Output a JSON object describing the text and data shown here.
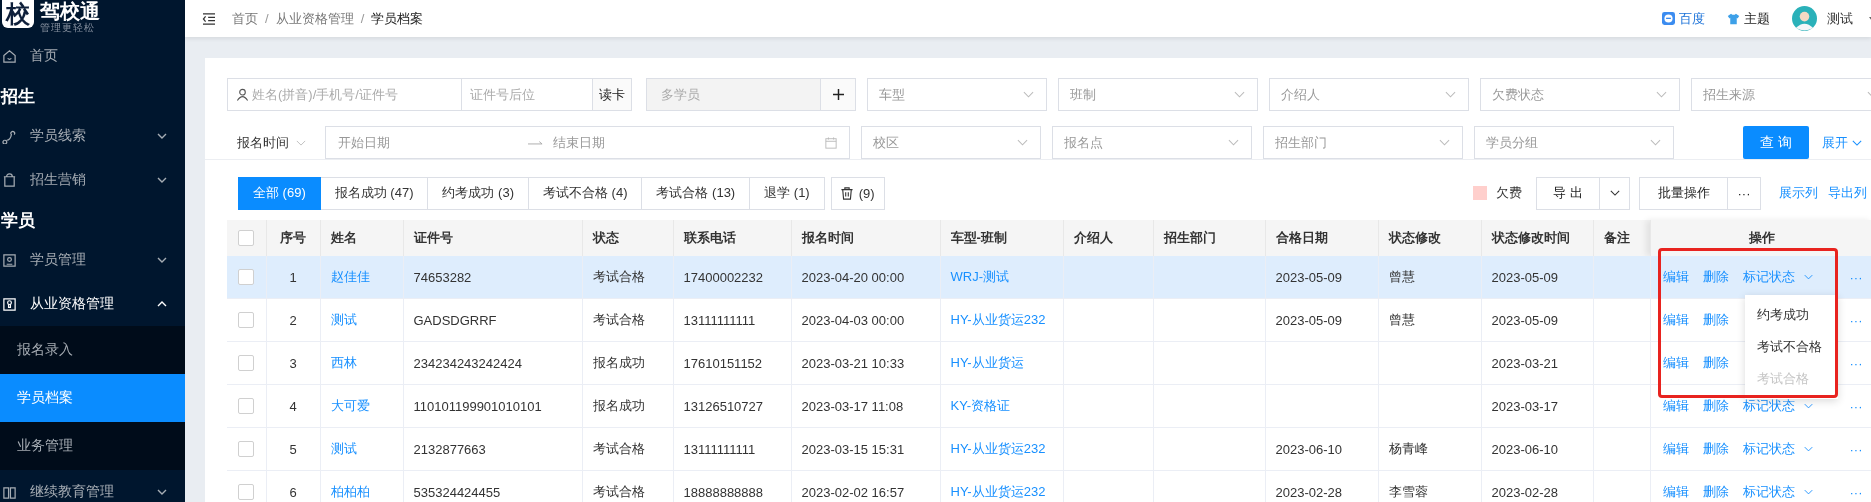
{
  "sidebar": {
    "logo": {
      "mark": "校",
      "name": "驾校通",
      "slogan": "管理更轻松"
    },
    "items": [
      {
        "kind": "item",
        "label": "首页"
      },
      {
        "kind": "section",
        "label": "招生"
      },
      {
        "kind": "item",
        "label": "学员线索",
        "expanded": false
      },
      {
        "kind": "item",
        "label": "招生营销",
        "expanded": false
      },
      {
        "kind": "section",
        "label": "学员"
      },
      {
        "kind": "item",
        "label": "学员管理",
        "expanded": false
      },
      {
        "kind": "item",
        "label": "从业资格管理",
        "expanded": true,
        "children": [
          {
            "label": "报名录入",
            "selected": false
          },
          {
            "label": "学员档案",
            "selected": true
          },
          {
            "label": "业务管理",
            "selected": false
          }
        ]
      },
      {
        "kind": "item",
        "label": "继续教育管理",
        "expanded": false
      }
    ]
  },
  "topbar": {
    "breadcrumb": [
      "首页",
      "从业资格管理",
      "学员档案"
    ],
    "separator": "/",
    "links": [
      {
        "kind": "browser",
        "label": "百度"
      },
      {
        "kind": "theme",
        "label": "主题"
      }
    ],
    "user": "测试"
  },
  "filters": {
    "name_search": {
      "placeholder": "姓名(拼音)/手机号/证件号"
    },
    "id_suffix": {
      "placeholder": "证件号后位"
    },
    "read_card": "读卡",
    "multi_student": {
      "placeholder": "多学员",
      "disabled": true
    },
    "selects_row1": [
      {
        "placeholder": "车型"
      },
      {
        "placeholder": "班制"
      },
      {
        "placeholder": "介绍人"
      },
      {
        "placeholder": "欠费状态"
      },
      {
        "placeholder": "招生来源"
      }
    ],
    "date_type": "报名时间",
    "date_start": {
      "placeholder": "开始日期"
    },
    "date_end": {
      "placeholder": "结束日期"
    },
    "selects_row2": [
      {
        "placeholder": "校区"
      },
      {
        "placeholder": "报名点"
      },
      {
        "placeholder": "招生部门"
      },
      {
        "placeholder": "学员分组"
      }
    ],
    "query_button": "查 询",
    "expand_link": "展开"
  },
  "tabs": [
    {
      "label": "全部 (69)",
      "selected": true
    },
    {
      "label": "报名成功 (47)",
      "selected": false
    },
    {
      "label": "约考成功 (3)",
      "selected": false
    },
    {
      "label": "考试不合格 (4)",
      "selected": false
    },
    {
      "label": "考试合格 (13)",
      "selected": false
    },
    {
      "label": "退学 (1)",
      "selected": false
    }
  ],
  "recycle_count": "(9)",
  "toolbar": {
    "legend": {
      "label": "欠费",
      "color": "#ffcfcc"
    },
    "export_button": "导 出",
    "batch_button": "批量操作",
    "more": "···",
    "links": [
      "展示列",
      "导出列"
    ]
  },
  "table": {
    "header_checked": false,
    "columns": [
      "序号",
      "姓名",
      "证件号",
      "状态",
      "联系电话",
      "报名时间",
      "车型-班制",
      "介绍人",
      "招生部门",
      "合格日期",
      "状态修改",
      "状态修改时间",
      "备注",
      "操作"
    ],
    "rows": [
      {
        "checked": false,
        "highlighted": true,
        "no": "1",
        "name": "赵佳佳",
        "id_number": "74653282",
        "status": "考试合格",
        "phone": "17400002232",
        "signup_time": "2023-04-20 00:00",
        "vehicle_class": "WRJ-测试",
        "pass_date": "2023-05-09",
        "modified_by": "曾慧",
        "modified_time": "2023-05-09",
        "actions": {
          "edit": "编辑",
          "delete": "删除",
          "mark": "标记状态",
          "more": "···"
        }
      },
      {
        "checked": false,
        "highlighted": false,
        "no": "2",
        "name": "测试",
        "id_number": "GADSDGRRF",
        "status": "考试合格",
        "phone": "13111111111",
        "signup_time": "2023-04-03 00:00",
        "vehicle_class": "HY-从业货运232",
        "pass_date": "2023-05-09",
        "modified_by": "曾慧",
        "modified_time": "2023-05-09",
        "actions": {
          "edit": "编辑",
          "delete": "删除",
          "more": "···"
        }
      },
      {
        "checked": false,
        "highlighted": false,
        "no": "3",
        "name": "西林",
        "id_number": "234234243242424",
        "status": "报名成功",
        "phone": "17610151152",
        "signup_time": "2023-03-21 10:33",
        "vehicle_class": "HY-从业货运",
        "modified_time": "2023-03-21",
        "actions": {
          "edit": "编辑",
          "delete": "删除",
          "more": "···"
        }
      },
      {
        "checked": false,
        "highlighted": false,
        "no": "4",
        "name": "大可爱",
        "id_number": "110101199901010101",
        "status": "报名成功",
        "phone": "13126510727",
        "signup_time": "2023-03-17 11:08",
        "vehicle_class": "KY-资格证",
        "modified_time": "2023-03-17",
        "actions": {
          "edit": "编辑",
          "delete": "删除",
          "mark": "标记状态",
          "more": "···"
        }
      },
      {
        "checked": false,
        "highlighted": false,
        "no": "5",
        "name": "测试",
        "id_number": "2132877663",
        "status": "考试合格",
        "phone": "13111111111",
        "signup_time": "2023-03-15 15:31",
        "vehicle_class": "HY-从业货运232",
        "pass_date": "2023-06-10",
        "modified_by": "杨青峰",
        "modified_time": "2023-06-10",
        "actions": {
          "edit": "编辑",
          "delete": "删除",
          "mark": "标记状态",
          "more": "···"
        }
      },
      {
        "checked": false,
        "highlighted": false,
        "no": "6",
        "name": "柏柏柏",
        "id_number": "535324424455",
        "status": "考试合格",
        "phone": "18888888888",
        "signup_time": "2023-02-02 16:57",
        "vehicle_class": "HY-从业货运232",
        "pass_date": "2023-02-28",
        "modified_by": "李雪蓉",
        "modified_time": "2023-02-28",
        "actions": {
          "edit": "编辑",
          "delete": "删除",
          "mark": "标记状态",
          "more": "···"
        }
      }
    ]
  },
  "status_menu": {
    "items": [
      {
        "label": "约考成功",
        "disabled": false
      },
      {
        "label": "考试不合格",
        "disabled": false
      },
      {
        "label": "考试合格",
        "disabled": true
      }
    ]
  },
  "annotation": {
    "kind": "frame",
    "color": "#e8231f"
  }
}
